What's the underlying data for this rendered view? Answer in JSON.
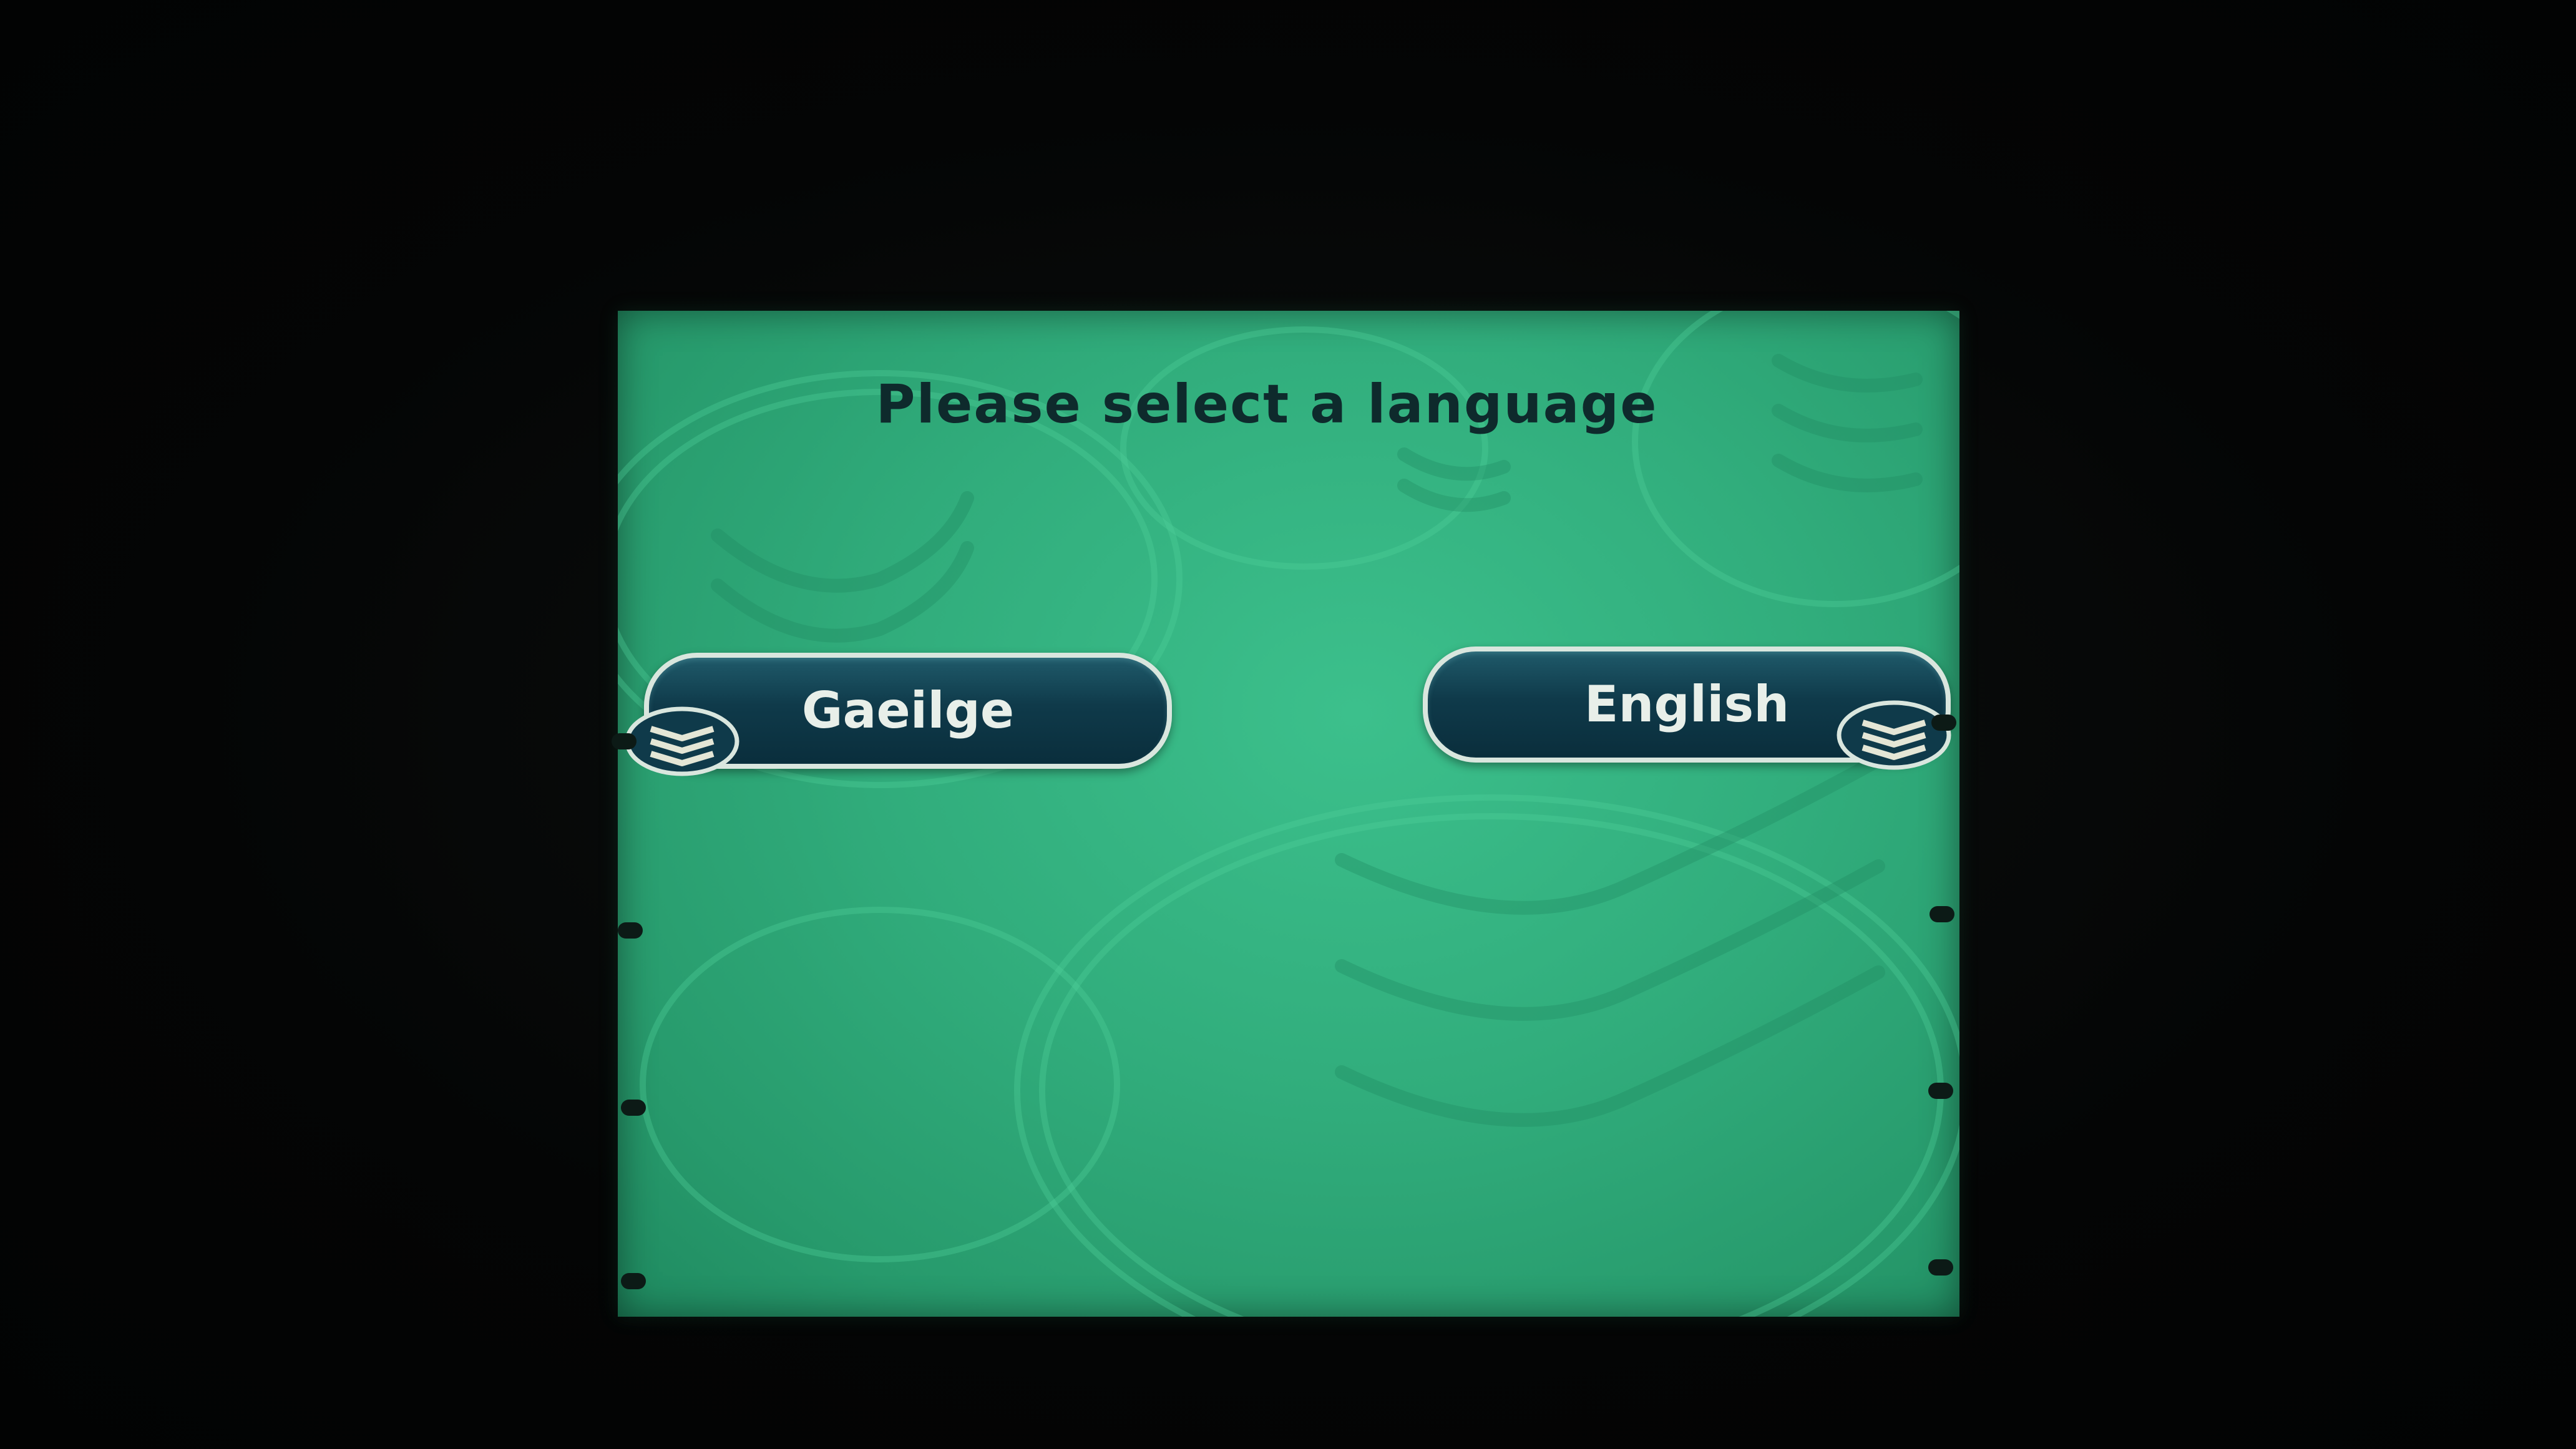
{
  "screen": {
    "title": "Please select a language",
    "colors": {
      "background": "#31ad7c",
      "button": "#0f3a4a",
      "title_text": "#0e2a2c",
      "button_text": "#e8efe9"
    }
  },
  "language_buttons": [
    {
      "label": "Gaeilge",
      "icon": "bank-emblem-icon"
    },
    {
      "label": "English",
      "icon": "bank-emblem-icon"
    }
  ]
}
